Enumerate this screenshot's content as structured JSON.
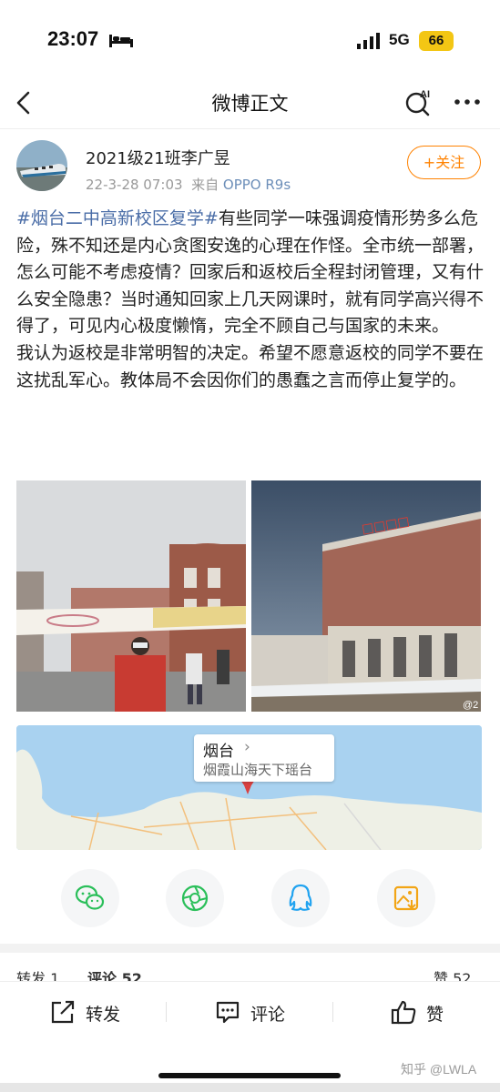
{
  "status_bar": {
    "time": "23:07",
    "network": "5G",
    "battery": "66"
  },
  "nav": {
    "title": "微博正文"
  },
  "post": {
    "username": "2021级21班李广昱",
    "timestamp": "22-3-28 07:03",
    "source_prefix": "来自",
    "source_device": "OPPO R9s",
    "follow_label": "+关注",
    "hashtag": "#烟台二中高新校区复学#",
    "text_1": "有些同学一味强调疫情形势多么危险，殊不知还是内心贪图安逸的心理在作怪。全市统一部署，怎么可能不考虑疫情？回家后和返校后全程封闭管理，又有什么安全隐患？当时通知回家上几天网课时，就有同学高兴得不得了，可见内心极度懒惰，完全不顾自己与国家的未来。",
    "text_2": "我认为返校是非常明智的决定。希望不愿意返校的同学不要在这扰乱军心。教体局不会因你们的愚蠢之言而停止复学的。"
  },
  "location": {
    "city": "烟台",
    "description": "烟霞山海天下瑶台"
  },
  "stats": {
    "repost": "转发 1",
    "comment": "评论 52",
    "like": "赞 52"
  },
  "actions": {
    "repost": "转发",
    "comment": "评论",
    "like": "赞"
  },
  "watermark": "知乎 @LWLA",
  "colors": {
    "accent": "#ff8200",
    "link": "#4a6da7",
    "battery": "#f3c614"
  }
}
